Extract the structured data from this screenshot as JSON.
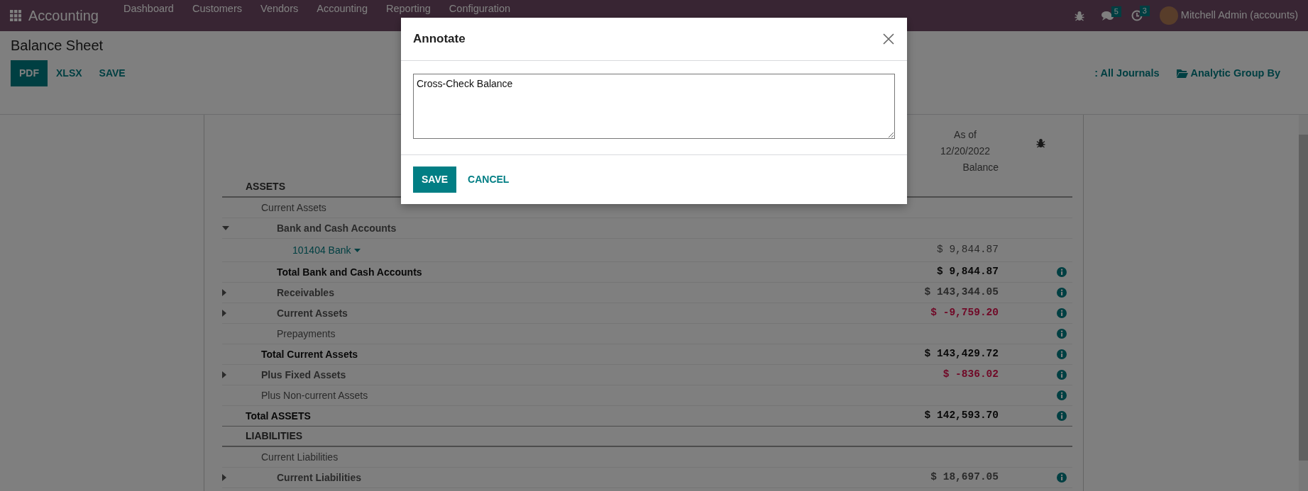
{
  "navbar": {
    "app_name": "Accounting",
    "menu": [
      "Dashboard",
      "Customers",
      "Vendors",
      "Accounting",
      "Reporting",
      "Configuration"
    ],
    "messages_count": "5",
    "activities_count": "3",
    "user": "Mitchell Admin (accounts)"
  },
  "control_panel": {
    "title": "Balance Sheet",
    "buttons": [
      {
        "label": "PDF",
        "primary": true
      },
      {
        "label": "XLSX",
        "primary": false
      },
      {
        "label": "SAVE",
        "primary": false
      }
    ],
    "filters": [
      {
        "label": ": All Journals"
      },
      {
        "label": "Analytic Group By"
      }
    ]
  },
  "report": {
    "header": {
      "date_line_1": "As of",
      "date_line_2": "12/20/2022",
      "column": "Balance"
    },
    "rows": [
      {
        "name": "ASSETS",
        "kind": "section",
        "children": [
          {
            "name": "Current Assets",
            "kind": "line",
            "info": false,
            "children": [
              {
                "name": "Bank and Cash Accounts",
                "kind": "group",
                "expanded": true,
                "info": false,
                "children": [
                  {
                    "name": "101404 Bank",
                    "kind": "account",
                    "balance": "$ 9,844.87",
                    "negative": false,
                    "info": false
                  }
                ]
              },
              {
                "name": "Total Bank and Cash Accounts",
                "kind": "total",
                "balance": "$ 9,844.87",
                "negative": false,
                "info": true
              },
              {
                "name": "Receivables",
                "kind": "group",
                "expanded": false,
                "balance": "$ 143,344.05",
                "negative": false,
                "info": true
              },
              {
                "name": "Current Assets",
                "kind": "group",
                "expanded": false,
                "balance": "$ -9,759.20",
                "negative": true,
                "info": true
              },
              {
                "name": "Prepayments",
                "kind": "line",
                "info": true
              }
            ]
          },
          {
            "name": "Total Current Assets",
            "kind": "total",
            "balance": "$ 143,429.72",
            "negative": false,
            "info": true
          },
          {
            "name": "Plus Fixed Assets",
            "kind": "group",
            "expanded": false,
            "balance": "$ -836.02",
            "negative": true,
            "info": true
          },
          {
            "name": "Plus Non-current Assets",
            "kind": "line",
            "info": true
          }
        ]
      },
      {
        "name": "Total ASSETS",
        "kind": "total",
        "balance": "$ 142,593.70",
        "negative": false,
        "info": true
      },
      {
        "name": "LIABILITIES",
        "kind": "section",
        "children": [
          {
            "name": "Current Liabilities",
            "kind": "line",
            "info": false,
            "children": [
              {
                "name": "Current Liabilities",
                "kind": "group",
                "expanded": false,
                "balance": "$ 18,697.05",
                "negative": false,
                "info": true
              }
            ]
          }
        ]
      }
    ]
  },
  "dialog": {
    "title": "Annotate",
    "text": "Cross-Check Balance",
    "buttons": [
      {
        "label": "SAVE",
        "primary": true
      },
      {
        "label": "CANCEL",
        "primary": false
      }
    ]
  }
}
